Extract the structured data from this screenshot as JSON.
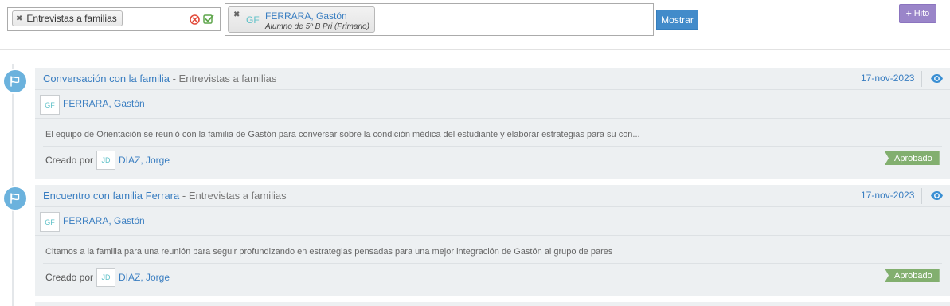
{
  "filters": {
    "type_tag": "Entrevistas a familias",
    "person_tag": {
      "initials": "GF",
      "name": "FERRARA, Gastón",
      "subtitle": "Alumno de 5º B Pri (Primario)"
    },
    "show_button": "Mostrar",
    "milestone_button": "Hito"
  },
  "entries": [
    {
      "title": "Conversación con la familia",
      "separator": " - ",
      "category": "Entrevistas a familias",
      "date": "17-nov-2023",
      "student_initials": "GF",
      "student_name": "FERRARA, Gastón",
      "description": "El equipo de Orientación se reunió con la familia de Gastón para conversar sobre la condición médica del estudiante y elaborar estrategias para su con...",
      "created_by_label": "Creado por",
      "creator_initials": "JD",
      "creator_name": "DIAZ, Jorge",
      "status": "Aprobado"
    },
    {
      "title": "Encuentro con familia Ferrara",
      "separator": " - ",
      "category": "Entrevistas a familias",
      "date": "17-nov-2023",
      "student_initials": "GF",
      "student_name": "FERRARA, Gastón",
      "description": "Citamos a la familia para una reunión para seguir profundizando en estrategias pensadas para una mejor integración de Gastón al grupo de pares",
      "created_by_label": "Creado por",
      "creator_initials": "JD",
      "creator_name": "DIAZ, Jorge",
      "status": "Aprobado"
    }
  ],
  "colors": {
    "link": "#3a7ec1",
    "approved": "#82af6f",
    "timeline_dot": "#6bb2dd",
    "card_bg": "#edf0f2",
    "primary_button": "#428bca",
    "milestone_button": "#9a85c9"
  },
  "icons": {
    "clear": "times-circle-icon",
    "apply": "check-square-icon",
    "timeline": "flag-icon",
    "view": "eye-icon",
    "remove": "close-icon",
    "add": "plus-icon"
  }
}
